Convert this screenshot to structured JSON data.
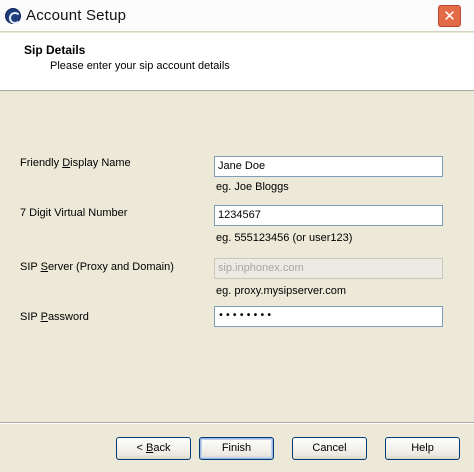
{
  "window": {
    "title": "Account Setup",
    "close_label": "✕"
  },
  "header": {
    "title": "Sip Details",
    "subtitle": "Please enter your sip account details"
  },
  "fields": {
    "display_name": {
      "label_pre": "Friendly ",
      "label_key": "D",
      "label_post": "isplay Name",
      "value": "Jane Doe",
      "hint": "eg.  Joe Bloggs"
    },
    "virtual_number": {
      "label": "7 Digit Virtual Number",
      "value": "1234567",
      "hint": "eg.  555123456  (or user123)"
    },
    "sip_server": {
      "label_pre": "SIP ",
      "label_key": "S",
      "label_post": "erver (Proxy and Domain)",
      "value": "sip.inphonex.com",
      "hint": "eg. proxy.mysipserver.com"
    },
    "sip_password": {
      "label_pre": "SIP ",
      "label_key": "P",
      "label_post": "assword",
      "value": "••••••••"
    }
  },
  "buttons": {
    "back_pre": "< ",
    "back_key": "B",
    "back_post": "ack",
    "finish": "Finish",
    "cancel": "Cancel",
    "help": "Help"
  }
}
